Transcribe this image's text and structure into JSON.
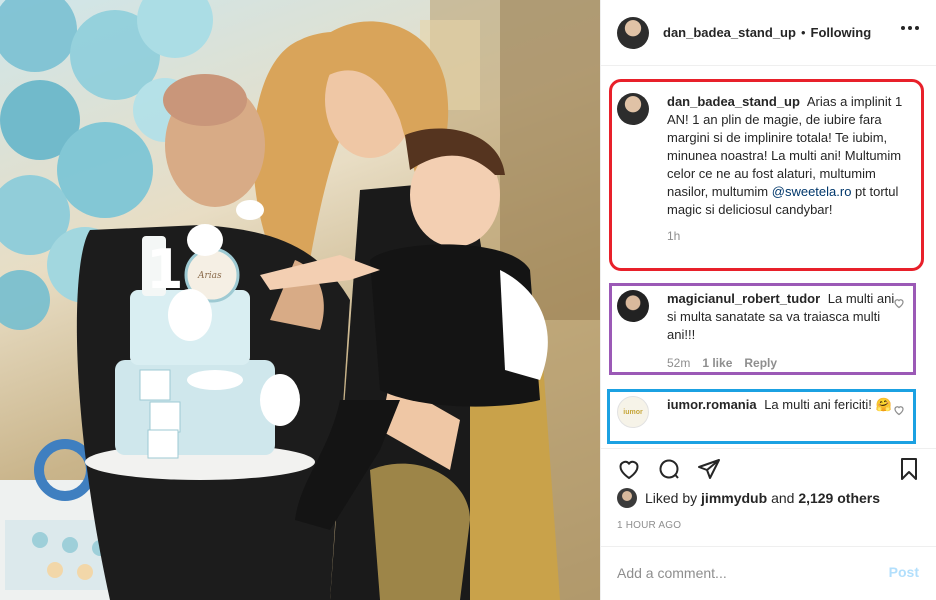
{
  "header": {
    "username": "dan_badea_stand_up",
    "separator": "•",
    "follow_status": "Following"
  },
  "caption": {
    "username": "dan_badea_stand_up",
    "text_before": "Arias a implinit 1 AN! 1 an plin de magie, de iubire fara margini si de implinire totala! Te iubim, minunea noastra! La multi ani! Multumim celor ce ne au fost alaturi, multumim nasilor, multumim ",
    "mention": "@sweetela.ro",
    "text_after": " pt tortul magic si deliciosul candybar!",
    "time": "1h"
  },
  "comments": [
    {
      "username": "magicianul_robert_tudor",
      "text": "La multi ani si multa sanatate sa va traiasca multi ani!!!",
      "time": "52m",
      "likes": "1 like",
      "reply": "Reply"
    },
    {
      "username": "iumor.romania",
      "text": "La multi ani fericiti! 🤗",
      "avatar_text": "iumor"
    }
  ],
  "likes": {
    "prefix": "Liked by ",
    "user": "jimmydub",
    "middle": " and ",
    "others": "2,129 others"
  },
  "timestamp": "1 HOUR AGO",
  "add_comment": {
    "placeholder": "Add a comment...",
    "post_label": "Post"
  },
  "photo": {
    "cake_number": "1",
    "cake_plaque": "Arias"
  },
  "colors": {
    "red_box": "#e8202a",
    "purple_box": "#9b59b6",
    "blue_box": "#1ba1e2",
    "post_disabled": "#b2dffc"
  }
}
